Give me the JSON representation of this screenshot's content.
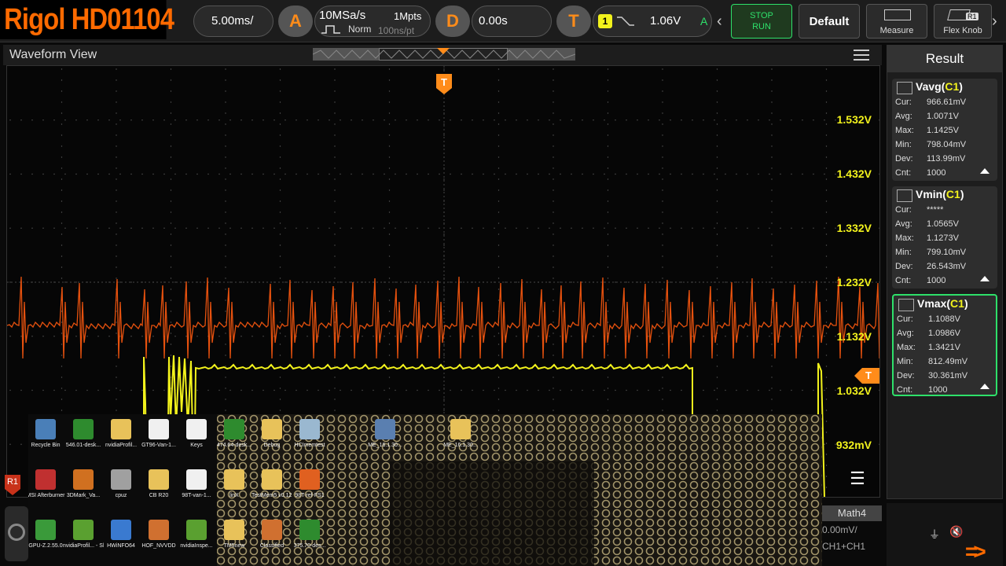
{
  "brand": "Rigol HD01104",
  "timebase": {
    "value": "5.00ms/"
  },
  "acquisition": {
    "badge": "A",
    "rate": "10MSa/s",
    "depth": "1Mpts",
    "mode": "Norm",
    "resolution": "100ns/pt"
  },
  "delay": {
    "badge": "D",
    "value": "0.00s"
  },
  "trigger": {
    "badge": "T",
    "channel": "1",
    "level": "1.06V",
    "mode": "A"
  },
  "buttons": {
    "stop_run_top": "STOP",
    "stop_run_bottom": "RUN",
    "default": "Default",
    "measure": "Measure",
    "flex_knob": "Flex Knob",
    "flex_badge": "R1"
  },
  "waveform_view": {
    "title": "Waveform View",
    "trigger_marker": "T",
    "ref_marker": "R1"
  },
  "voltage_labels": [
    "1.532V",
    "1.432V",
    "1.332V",
    "1.232V",
    "1.132V",
    "1.032V",
    "932mV"
  ],
  "result": {
    "title": "Result",
    "cards": [
      {
        "name": "Vavg",
        "channel": "C1",
        "rows": [
          [
            "Cur:",
            "966.61mV"
          ],
          [
            "Avg:",
            "1.0071V"
          ],
          [
            "Max:",
            "1.1425V"
          ],
          [
            "Min:",
            "798.04mV"
          ],
          [
            "Dev:",
            "113.99mV"
          ],
          [
            "Cnt:",
            "1000"
          ]
        ]
      },
      {
        "name": "Vmin",
        "channel": "C1",
        "rows": [
          [
            "Cur:",
            "*****"
          ],
          [
            "Avg:",
            "1.0565V"
          ],
          [
            "Max:",
            "1.1273V"
          ],
          [
            "Min:",
            "799.10mV"
          ],
          [
            "Dev:",
            "26.543mV"
          ],
          [
            "Cnt:",
            "1000"
          ]
        ]
      },
      {
        "name": "Vmax",
        "channel": "C1",
        "rows": [
          [
            "Cur:",
            "1.1088V"
          ],
          [
            "Avg:",
            "1.0986V"
          ],
          [
            "Max:",
            "1.3421V"
          ],
          [
            "Min:",
            "812.49mV"
          ],
          [
            "Dev:",
            "30.361mV"
          ],
          [
            "Cnt:",
            "1000"
          ]
        ]
      }
    ]
  },
  "math": {
    "tab": "Math4",
    "scale": "0.00mV/",
    "expr": "CH1+CH1"
  },
  "desktop_icons": [
    {
      "label": "Recycle Bin",
      "color": "#4a7fb8"
    },
    {
      "label": "546.01-desk...",
      "color": "#2e8b2e"
    },
    {
      "label": "nvidiaProfil...",
      "color": "#e8c25a"
    },
    {
      "label": "GT96-Van-1...",
      "color": "#f0f0f0"
    },
    {
      "label": "Keys",
      "color": "#f0f0f0"
    },
    {
      "label": "474.64-desk...",
      "color": "#2e8b2e"
    },
    {
      "label": "Debug",
      "color": "#e8c25a"
    },
    {
      "label": "HCImemtest",
      "color": "#9ab8d0"
    },
    {
      "label": "ME_16.1.30...",
      "color": "#5a7fb0"
    },
    {
      "label": "ME_16.1.30...",
      "color": "#e8c25a"
    },
    {
      "label": "MSI Afterburner",
      "color": "#c03030"
    },
    {
      "label": "3DMark_Va...",
      "color": "#d07020"
    },
    {
      "label": "cpuz",
      "color": "#a0a0a0"
    },
    {
      "label": "CB R20",
      "color": "#e8c25a"
    },
    {
      "label": "98T-van-1...",
      "color": "#f0f0f0"
    },
    {
      "label": "linX",
      "color": "#e8c25a"
    },
    {
      "label": "TestMem5 v0.12 (be...",
      "color": "#e8c25a"
    },
    {
      "label": "98T-ref-FS1",
      "color": "#e06020"
    },
    {
      "label": "GPU-Z.2.55.0",
      "color": "#3a9a3a"
    },
    {
      "label": "nvidiaProfil... - Shortcut",
      "color": "#5aa030"
    },
    {
      "label": "HWiNFO64",
      "color": "#3a7ad0"
    },
    {
      "label": "HOF_NVVDD",
      "color": "#d07030"
    },
    {
      "label": "nvidiaInspe...",
      "color": "#5aa030"
    },
    {
      "label": "TM5new",
      "color": "#e8c25a"
    },
    {
      "label": "Classified",
      "color": "#d07030"
    },
    {
      "label": "375.70-des...",
      "color": "#2e8b2e"
    }
  ],
  "colors": {
    "ch1": "#f2f21c",
    "ch2": "#ff5a10",
    "brand": "#ff6a00",
    "select": "#2ee06a"
  }
}
